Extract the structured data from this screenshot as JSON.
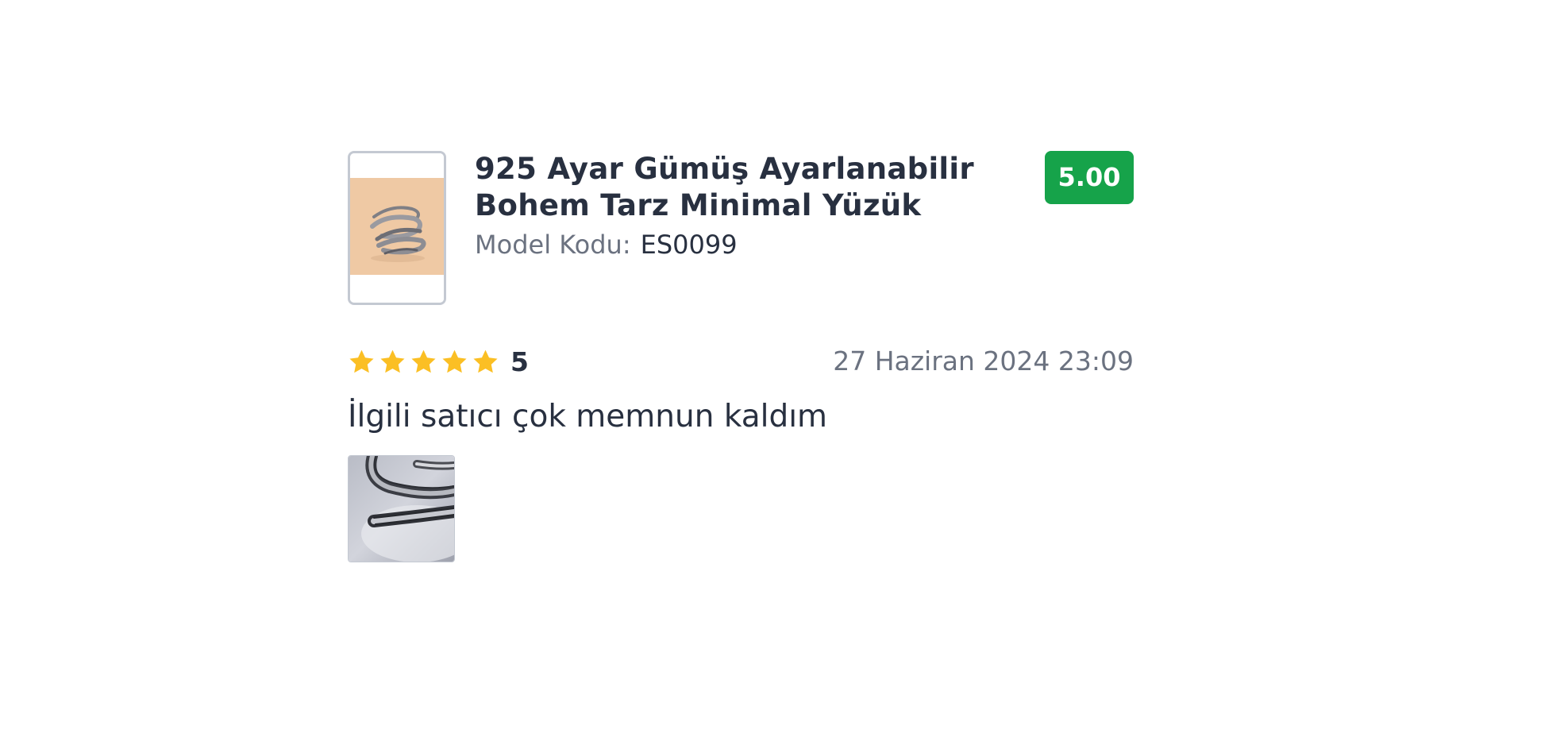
{
  "product": {
    "title": "925 Ayar Gümüş Ayarlanabilir Bohem Tarz Minimal Yüzük",
    "model_label": "Model Kodu:",
    "model_code": "ES0099",
    "score": "5.00",
    "image_icon": "ring-product-photo"
  },
  "review": {
    "rating": "5",
    "rating_value": 5,
    "rating_max": 5,
    "date": "27 Haziran 2024 23:09",
    "text": "İlgili satıcı çok memnun kaldım",
    "photo_icon": "ring-review-photo"
  },
  "colors": {
    "score_badge": "#16a34a",
    "star": "#fbbf24",
    "text_primary": "#283040",
    "text_secondary": "#6b7280"
  }
}
